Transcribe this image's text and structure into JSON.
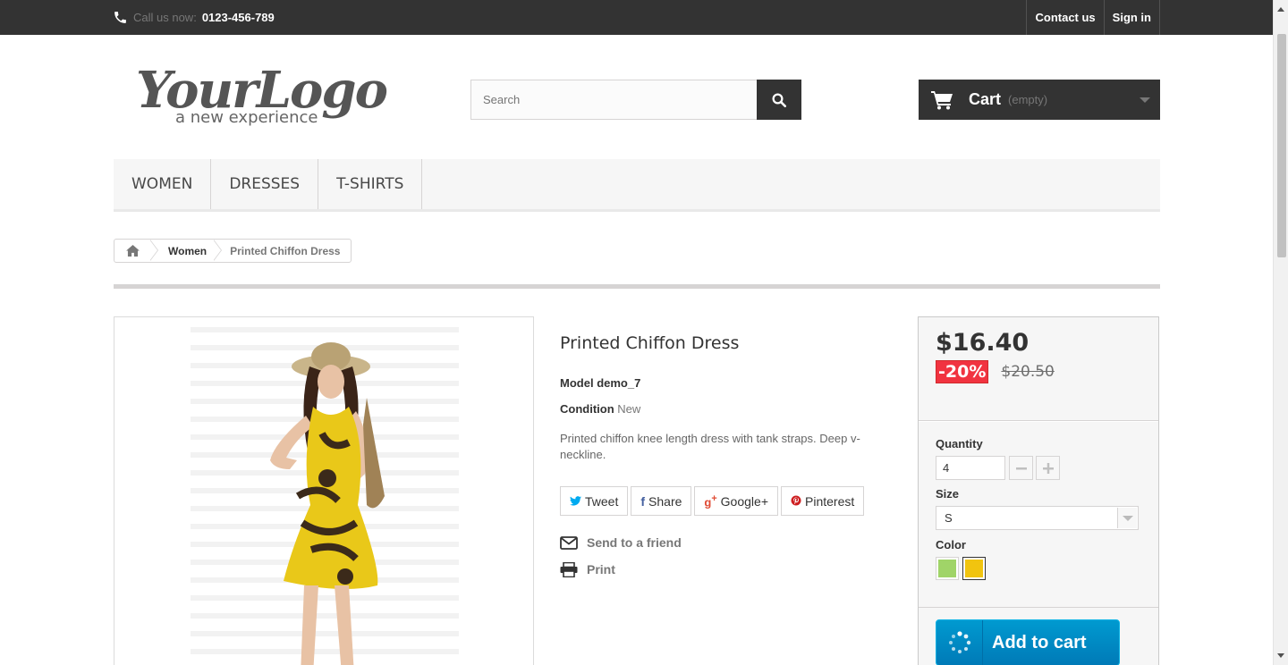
{
  "topbar": {
    "call_label": "Call us now:",
    "phone": "0123-456-789",
    "contact_link": "Contact us",
    "signin_link": "Sign in"
  },
  "header": {
    "logo_text": "YourLogo",
    "logo_tagline": "a new experience",
    "search_placeholder": "Search",
    "cart_label": "Cart",
    "cart_status": "(empty)"
  },
  "menu": {
    "items": [
      "WOMEN",
      "DRESSES",
      "T-SHIRTS"
    ]
  },
  "breadcrumb": {
    "category": "Women",
    "current": "Printed Chiffon Dress"
  },
  "product": {
    "name": "Printed Chiffon Dress",
    "model_label": "Model",
    "model_value": "demo_7",
    "condition_label": "Condition",
    "condition_value": "New",
    "description": "Printed chiffon knee length dress with tank straps. Deep v-neckline.",
    "social": {
      "tweet": "Tweet",
      "share": "Share",
      "google": "Google+",
      "pinterest": "Pinterest"
    },
    "send_friend": "Send to a friend",
    "print": "Print"
  },
  "buybox": {
    "price": "$16.40",
    "reduction": "-20%",
    "old_price": "$20.50",
    "quantity_label": "Quantity",
    "quantity_value": "4",
    "size_label": "Size",
    "size_value": "S",
    "color_label": "Color",
    "colors": [
      "#a0d468",
      "#f1c40f"
    ],
    "add_to_cart": "Add to cart"
  }
}
